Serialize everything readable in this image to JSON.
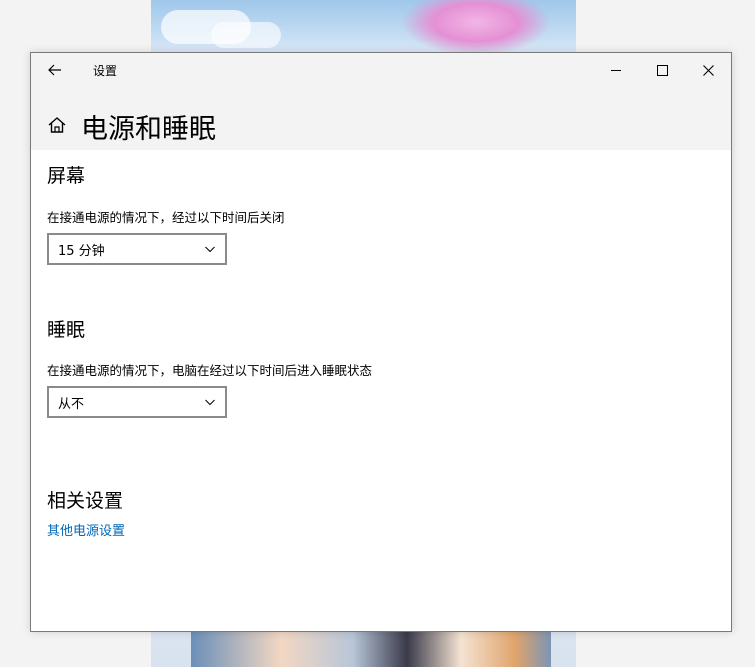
{
  "window": {
    "title": "设置"
  },
  "page": {
    "title": "电源和睡眠"
  },
  "screen": {
    "heading": "屏幕",
    "description": "在接通电源的情况下，经过以下时间后关闭",
    "selected": "15 分钟"
  },
  "sleep": {
    "heading": "睡眠",
    "description": "在接通电源的情况下，电脑在经过以下时间后进入睡眠状态",
    "selected": "从不"
  },
  "related": {
    "heading": "相关设置",
    "link": "其他电源设置"
  },
  "colors": {
    "link": "#0067b8",
    "titlebar_bg": "#f3f3f3",
    "dropdown_border": "#8a8a8a"
  },
  "icons": [
    "back-arrow-icon",
    "minimize-icon",
    "maximize-icon",
    "close-icon",
    "home-icon",
    "chevron-down-icon"
  ]
}
